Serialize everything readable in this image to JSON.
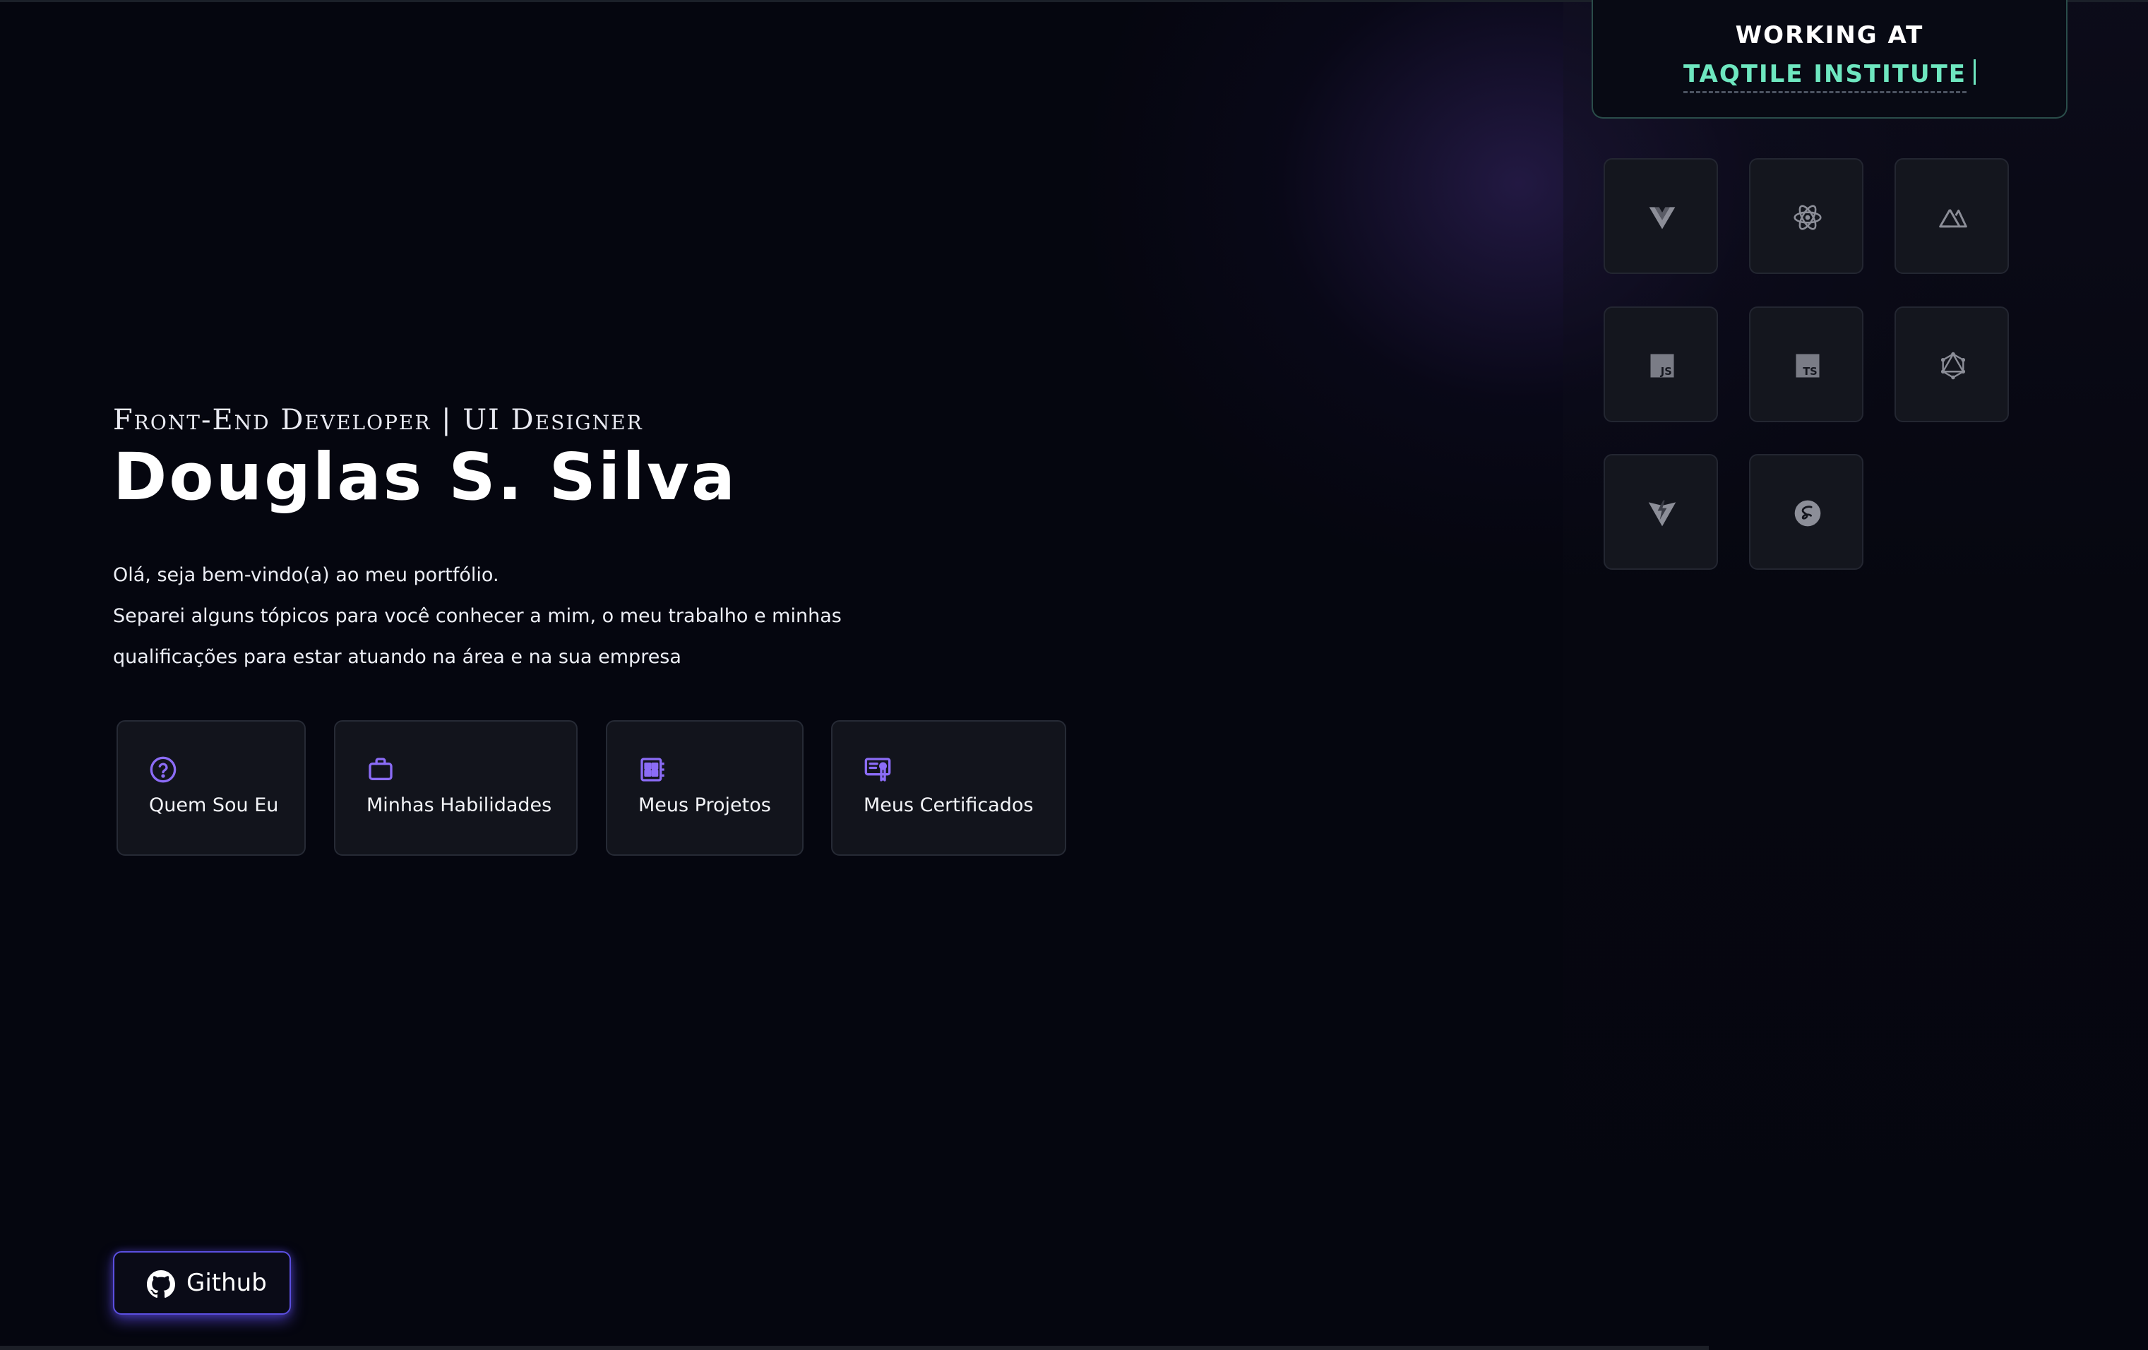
{
  "hero": {
    "subtitle": "Front-End Developer | UI Designer",
    "name": "Douglas S. Silva",
    "intro": [
      "Olá, seja bem-vindo(a) ao meu portfólio.",
      "Separei alguns tópicos para você conhecer a mim, o meu trabalho e minhas",
      "qualificações para estar atuando na área e na sua empresa"
    ]
  },
  "nav_cards": [
    {
      "label": "Quem Sou Eu",
      "icon": "question-circle-icon"
    },
    {
      "label": "Minhas Habilidades",
      "icon": "briefcase-icon"
    },
    {
      "label": "Meus Projetos",
      "icon": "projects-icon"
    },
    {
      "label": "Meus Certificados",
      "icon": "certificate-icon"
    }
  ],
  "github": {
    "label": "Github",
    "icon": "github-icon"
  },
  "working": {
    "title": "WORKING AT",
    "company": "TAQTILE INSTITUTE"
  },
  "tech_icons": [
    "vue-icon",
    "react-icon",
    "nuxt-icon",
    "javascript-icon",
    "typescript-icon",
    "graphql-icon",
    "vite-icon",
    "sass-icon"
  ],
  "colors": {
    "background": "#05060f",
    "accent": "#8b6cf6",
    "company": "#6ee7c0",
    "card": "#12141c",
    "github_glow": "#5b4fe0"
  }
}
